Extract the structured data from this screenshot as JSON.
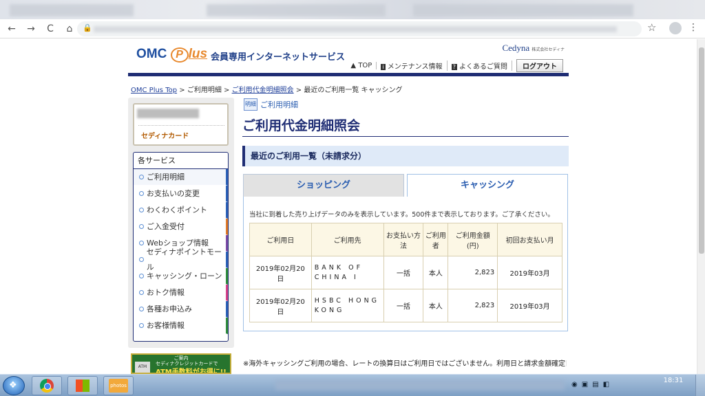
{
  "browser": {
    "nav": {
      "back": "←",
      "forward": "→",
      "reload": "C",
      "home": "⌂"
    },
    "star": "☆",
    "kebab": "⋮"
  },
  "header": {
    "logo_omc": "OMC",
    "logo_p": "P",
    "logo_lus": "lus",
    "service_name": "会員専用インターネットサービス",
    "cedyna": "Cedyna",
    "cedyna_sub": "株式会社セディナ",
    "nav": [
      {
        "icon": "home-icon",
        "glyph": "▲",
        "label": "TOP"
      },
      {
        "icon": "info-icon",
        "glyph": "i",
        "label": "メンテナンス情報"
      },
      {
        "icon": "help-icon",
        "glyph": "?",
        "label": "よくあるご質問"
      }
    ],
    "logout": "ログアウト"
  },
  "breadcrumb": {
    "home": "OMC Plus Top",
    "sep": ">",
    "item2": "ご利用明細",
    "item3": "ご利用代金明細照会",
    "current": "最近のご利用一覧 キャッシング"
  },
  "sidebar": {
    "card_name": "セディナカード",
    "services_title": "各サービス",
    "items": [
      {
        "label": "ご利用明細",
        "color": "#2c62b8"
      },
      {
        "label": "お支払いの変更",
        "color": "#2c62b8"
      },
      {
        "label": "わくわくポイント",
        "color": "#2c62b8"
      },
      {
        "label": "ご入金受付",
        "color": "#e07a28"
      },
      {
        "label": "Webショップ情報",
        "color": "#7b4ba6"
      },
      {
        "label": "セディナポイントモール",
        "color": "#2c62b8"
      },
      {
        "label": "キャッシング・ローン",
        "color": "#2f8d3d"
      },
      {
        "label": "おトク情報",
        "color": "#d6418a"
      },
      {
        "label": "各種お申込み",
        "color": "#2c62b8"
      },
      {
        "label": "お客様情報",
        "color": "#2f8d3d"
      }
    ],
    "promo": {
      "top": "ご案内",
      "line1": "セディナクレジットカードで",
      "line2": "ATM手数料がお得に!!",
      "atm": "ATM"
    }
  },
  "main": {
    "section_tag": "ご利用明細",
    "section_icon": "明細",
    "title": "ご利用代金明細照会",
    "subhead": "最近のご利用一覧（未請求分）",
    "tabs": {
      "shopping": "ショッピング",
      "cashing": "キャッシング"
    },
    "notice": "当社に到着した売り上げデータのみを表示しています。500件まで表示しております。ご了承ください。",
    "table": {
      "headers": [
        "ご利用日",
        "ご利用先",
        "お支払い方法",
        "ご利用者",
        "ご利用金額(円)",
        "初回お支払い月"
      ],
      "rows": [
        [
          "2019年02月20日",
          "BANK OF CHINA I",
          "一括",
          "本人",
          "2,823",
          "2019年03月"
        ],
        [
          "2019年02月20日",
          "HSBC HONG KONG",
          "一括",
          "本人",
          "2,823",
          "2019年03月"
        ]
      ]
    },
    "footnote": "※海外キャッシングご利用の場合、レートの換算日はご利用日ではございません。利用日と請求金額確定日に"
  },
  "taskbar": {
    "start": "❖",
    "photos": "photos",
    "clock": "18:31"
  }
}
